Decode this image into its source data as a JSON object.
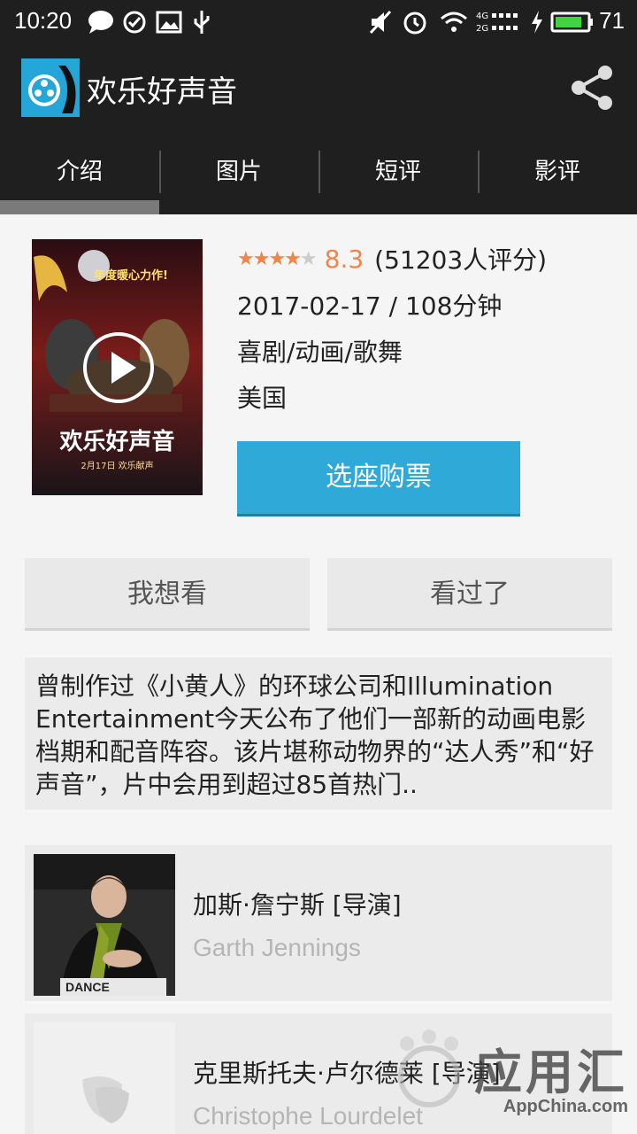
{
  "status_bar": {
    "time": "10:20",
    "battery": "71",
    "icons": [
      "chat-icon",
      "check-circle-icon",
      "image-icon",
      "usb-icon",
      "mute-icon",
      "alarm-icon",
      "wifi-icon",
      "signal-icon",
      "charging-icon",
      "battery-icon"
    ]
  },
  "app_bar": {
    "title": "欢乐好声音",
    "back_glyph": "〈",
    "share_icon": "share-icon"
  },
  "tabs": [
    {
      "label": "介绍",
      "selected": true
    },
    {
      "label": "图片",
      "selected": false
    },
    {
      "label": "短评",
      "selected": false
    },
    {
      "label": "影评",
      "selected": false
    }
  ],
  "movie": {
    "poster": {
      "tagline": "年度暖心力作!",
      "title": "欢乐好声音",
      "date_text": "2月17日 欢乐献声"
    },
    "stars_filled": "★★★★",
    "stars_empty": "★",
    "star_rating": 4,
    "score": "8.3",
    "rating_count": "(51203人评分)",
    "release_runtime": "2017-02-17 / 108分钟",
    "genres": "喜剧/动画/歌舞",
    "country": "美国",
    "buy_label": "选座购票"
  },
  "actions": {
    "want": "我想看",
    "watched": "看过了"
  },
  "synopsis": "曾制作过《小黄人》的环球公司和Illumination Entertainment今天公布了他们一部新的动画电影档期和配音阵容。该片堪称动物界的“达人秀”和“好声音”，片中会用到超过85首热门..",
  "people": [
    {
      "name": "加斯·詹宁斯 [导演]",
      "english": "Garth Jennings",
      "photo_caption": "DANCE"
    },
    {
      "name": "克里斯托夫·卢尔德莱 [导演]",
      "english": "Christophe Lourdelet"
    }
  ],
  "watermark": {
    "text": "应用汇",
    "sub": "AppChina.com"
  },
  "colors": {
    "bar": "#1f1f1f",
    "accent": "#2ea9d8",
    "star": "#f0854b"
  }
}
